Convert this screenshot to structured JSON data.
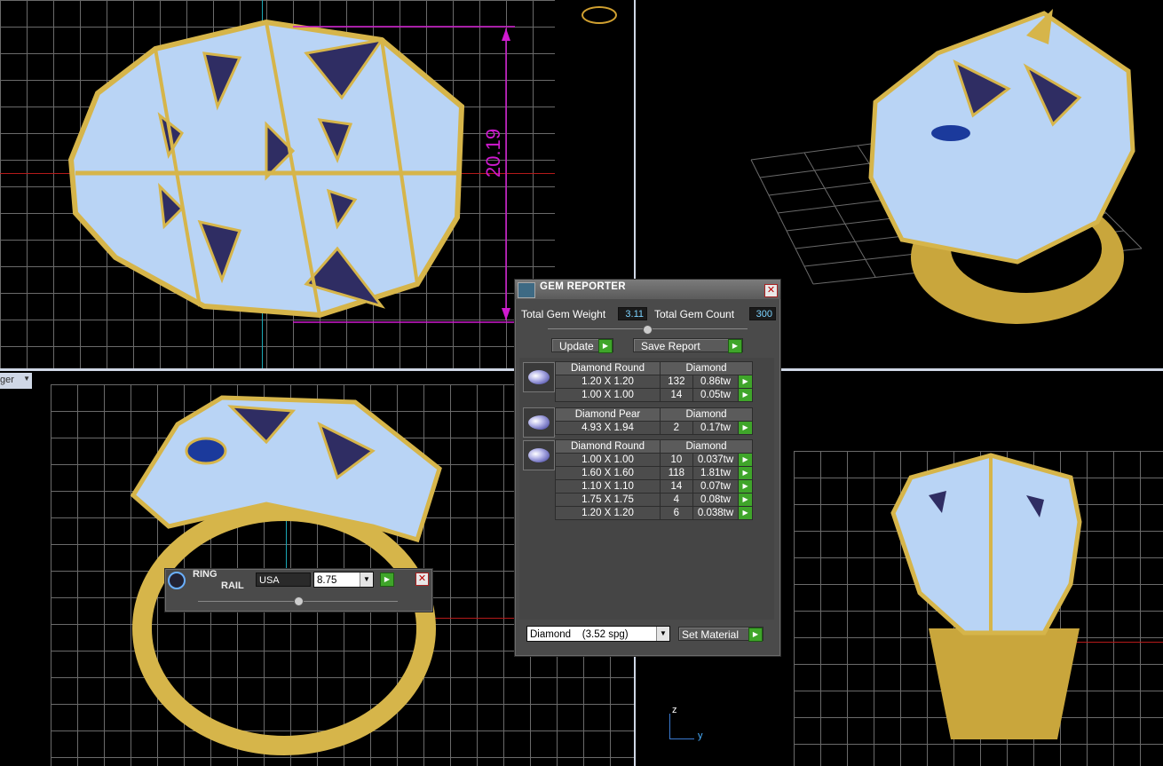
{
  "viewports": {
    "top_left": {
      "dimension_label": "20.19"
    },
    "bottom_left": {
      "view_selector": "ger"
    },
    "bottom_right": {
      "axis_z": "z",
      "axis_y": "y"
    }
  },
  "gem_reporter": {
    "title": "GEM REPORTER",
    "total_weight_label": "Total Gem Weight",
    "total_weight_value": "3.11",
    "total_count_label": "Total Gem Count",
    "total_count_value": "300",
    "update_label": "Update",
    "save_report_label": "Save Report",
    "groups": [
      {
        "shape": "Diamond Round",
        "material": "Diamond",
        "thumb": "round-gem-icon",
        "rows": [
          {
            "size": "1.20 X 1.20",
            "count": "132",
            "weight": "0.86tw"
          },
          {
            "size": "1.00 X 1.00",
            "count": "14",
            "weight": "0.05tw"
          }
        ]
      },
      {
        "shape": "Diamond Pear",
        "material": "Diamond",
        "thumb": "pear-gem-icon",
        "rows": [
          {
            "size": "4.93 X 1.94",
            "count": "2",
            "weight": "0.17tw"
          }
        ]
      },
      {
        "shape": "Diamond Round",
        "material": "Diamond",
        "thumb": "round-gem-icon",
        "rows": [
          {
            "size": "1.00 X 1.00",
            "count": "10",
            "weight": "0.037tw"
          },
          {
            "size": "1.60 X 1.60",
            "count": "118",
            "weight": "1.81tw"
          },
          {
            "size": "1.10 X 1.10",
            "count": "14",
            "weight": "0.07tw"
          },
          {
            "size": "1.75 X 1.75",
            "count": "4",
            "weight": "0.08tw"
          },
          {
            "size": "1.20 X 1.20",
            "count": "6",
            "weight": "0.038tw"
          }
        ]
      }
    ],
    "material_select": "Diamond    (3.52 spg)",
    "set_material_label": "Set Material"
  },
  "ring_rail": {
    "title_line1": "RING",
    "title_line2": "RAIL",
    "standard": "USA",
    "size": "8.75"
  },
  "colors": {
    "gold": "#d6b54a",
    "pave": "#b9d4f5",
    "enamel": "#2f2d63",
    "dimension": "#d01ad0",
    "panel": "#4a4a4a",
    "go_button": "#3fa52a"
  }
}
